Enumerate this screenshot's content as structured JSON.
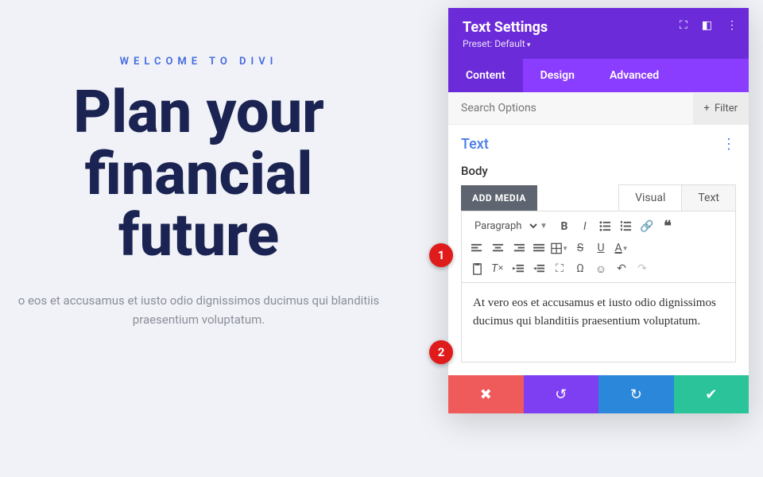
{
  "page": {
    "eyebrow": "WELCOME TO DIVI",
    "title": "Plan your financial future",
    "body": "o eos et accusamus et iusto odio dignissimos ducimus qui blanditiis praesentium voluptatum."
  },
  "panel": {
    "title": "Text Settings",
    "preset": "Preset: Default",
    "tabs": {
      "content": "Content",
      "design": "Design",
      "advanced": "Advanced"
    },
    "search_placeholder": "Search Options",
    "filter_label": "Filter",
    "section_title": "Text",
    "field_label": "Body",
    "add_media": "ADD MEDIA",
    "editor_tabs": {
      "visual": "Visual",
      "text": "Text"
    },
    "format_select": "Paragraph",
    "editor_content": "At vero eos et accusamus et iusto odio dignissimos ducimus qui blanditiis praesentium voluptatum."
  },
  "callouts": {
    "one": "1",
    "two": "2"
  }
}
